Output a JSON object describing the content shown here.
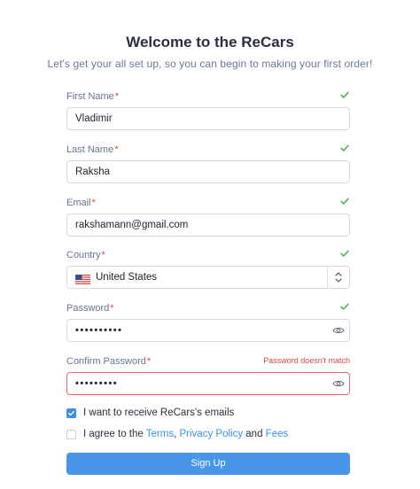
{
  "header": {
    "title": "Welcome to the ReCars",
    "subtitle": "Let's get your all set up, so you can begin to making your first order!"
  },
  "form": {
    "first_name": {
      "label": "First Name",
      "value": "Vladimir"
    },
    "last_name": {
      "label": "Last Name",
      "value": "Raksha"
    },
    "email": {
      "label": "Email",
      "value": "rakshamann@gmail.com"
    },
    "country": {
      "label": "Country",
      "value": "United States"
    },
    "password": {
      "label": "Password",
      "value": "••••••••••"
    },
    "confirm_password": {
      "label": "Confirm Password",
      "value": "•••••••••",
      "error": "Password doesn't match"
    },
    "required_marker": "*"
  },
  "options": {
    "emails_label": "I want to receive ReCars's emails",
    "emails_checked": true,
    "agree_prefix": "I agree to the",
    "terms_link": "Terms",
    "comma": ",",
    "privacy_link": "Privacy Policy",
    "and": "and",
    "fees_link": "Fees",
    "agree_checked": false
  },
  "actions": {
    "signup_label": "Sign Up"
  },
  "colors": {
    "accent": "#4896e8",
    "valid": "#4caf50",
    "error": "#d64545"
  }
}
